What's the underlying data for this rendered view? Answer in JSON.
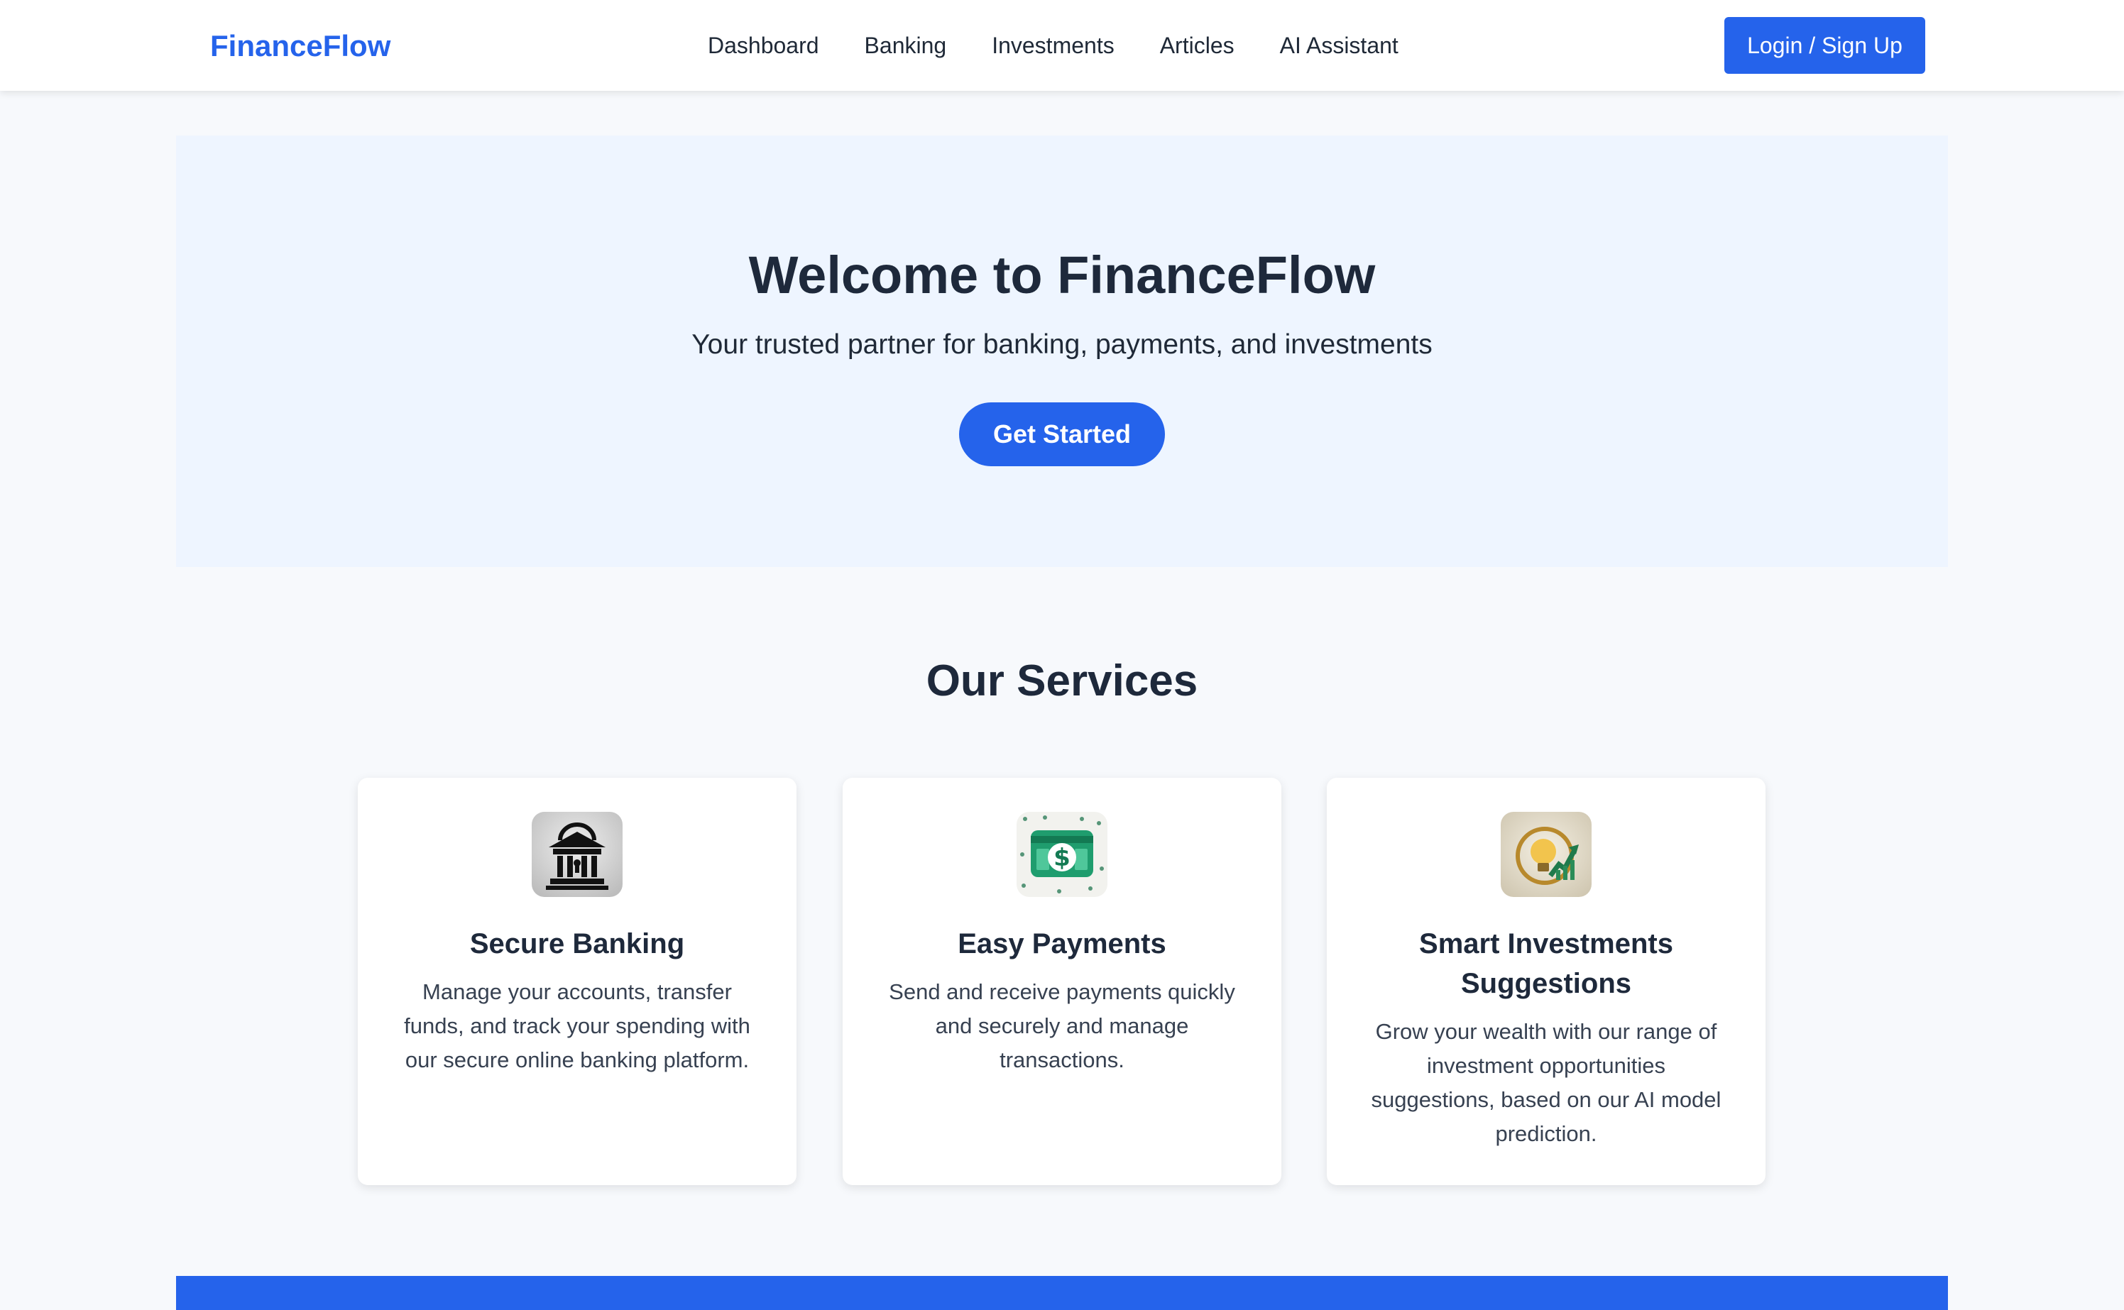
{
  "header": {
    "brand": "FinanceFlow",
    "nav": [
      "Dashboard",
      "Banking",
      "Investments",
      "Articles",
      "AI Assistant"
    ],
    "login_label": "Login / Sign Up"
  },
  "hero": {
    "title": "Welcome to FinanceFlow",
    "subtitle": "Your trusted partner for banking, payments, and investments",
    "cta_label": "Get Started"
  },
  "services": {
    "title": "Our Services",
    "cards": [
      {
        "icon": "bank-icon",
        "title": "Secure Banking",
        "description": "Manage your accounts, transfer funds, and track your spending with our secure online banking platform."
      },
      {
        "icon": "dollar-card-icon",
        "title": "Easy Payments",
        "description": "Send and receive payments quickly and securely and manage transactions."
      },
      {
        "icon": "lightbulb-growth-icon",
        "title": "Smart Investments Suggestions",
        "description": "Grow your wealth with our range of investment opportunities suggestions, based on our AI model prediction."
      }
    ]
  },
  "colors": {
    "accent": "#2563eb",
    "hero_background": "#eef5ff",
    "page_background": "#f7f9fc",
    "heading": "#1e293b"
  }
}
